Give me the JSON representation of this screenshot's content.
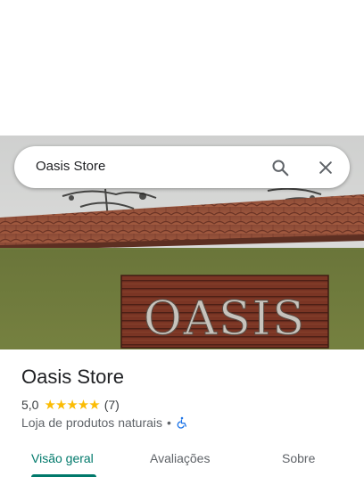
{
  "search": {
    "query": "Oasis Store"
  },
  "photo": {
    "sign_text": "OASIS"
  },
  "place": {
    "name": "Oasis Store",
    "rating": "5,0",
    "stars": "★★★★★",
    "review_count": "(7)",
    "category": "Loja de produtos naturais",
    "separator": "•"
  },
  "tabs": [
    {
      "label": "Visão geral",
      "active": true
    },
    {
      "label": "Avaliações",
      "active": false
    },
    {
      "label": "Sobre",
      "active": false
    }
  ],
  "colors": {
    "accent": "#00796b",
    "star": "#fbbc04",
    "wheelchair": "#1a73e8"
  },
  "icons": [
    "search-icon",
    "close-icon",
    "wheelchair-icon"
  ]
}
